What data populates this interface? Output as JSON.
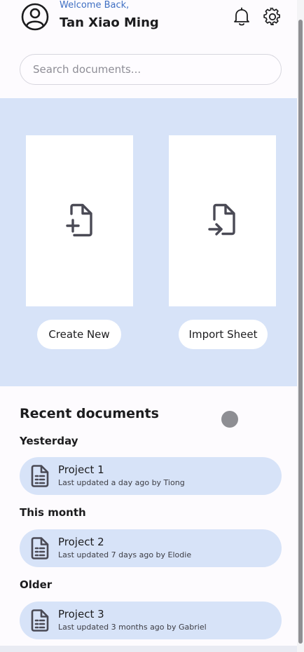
{
  "header": {
    "welcome": "Welcome Back,",
    "username": "Tan Xiao Ming",
    "icons": [
      "account-circle-icon",
      "bell-icon",
      "gear-icon"
    ]
  },
  "search": {
    "placeholder": "Search documents...",
    "value": ""
  },
  "actions": {
    "create_label": "Create New",
    "import_label": "Import Sheet"
  },
  "recent": {
    "title": "Recent documents",
    "groups": [
      {
        "label": "Yesterday",
        "items": [
          {
            "name": "Project 1",
            "meta": "Last updated a day ago by Tiong"
          }
        ]
      },
      {
        "label": "This month",
        "items": [
          {
            "name": "Project 2",
            "meta": "Last updated 7 days ago by Elodie"
          }
        ]
      },
      {
        "label": "Older",
        "items": [
          {
            "name": "Project 3",
            "meta": "Last updated 3 months ago by Gabriel"
          }
        ]
      }
    ]
  },
  "colors": {
    "accent": "#3f6fc3",
    "panel": "#d7e3f8",
    "background": "#fdfbfe",
    "icon": "#4a4a55"
  }
}
